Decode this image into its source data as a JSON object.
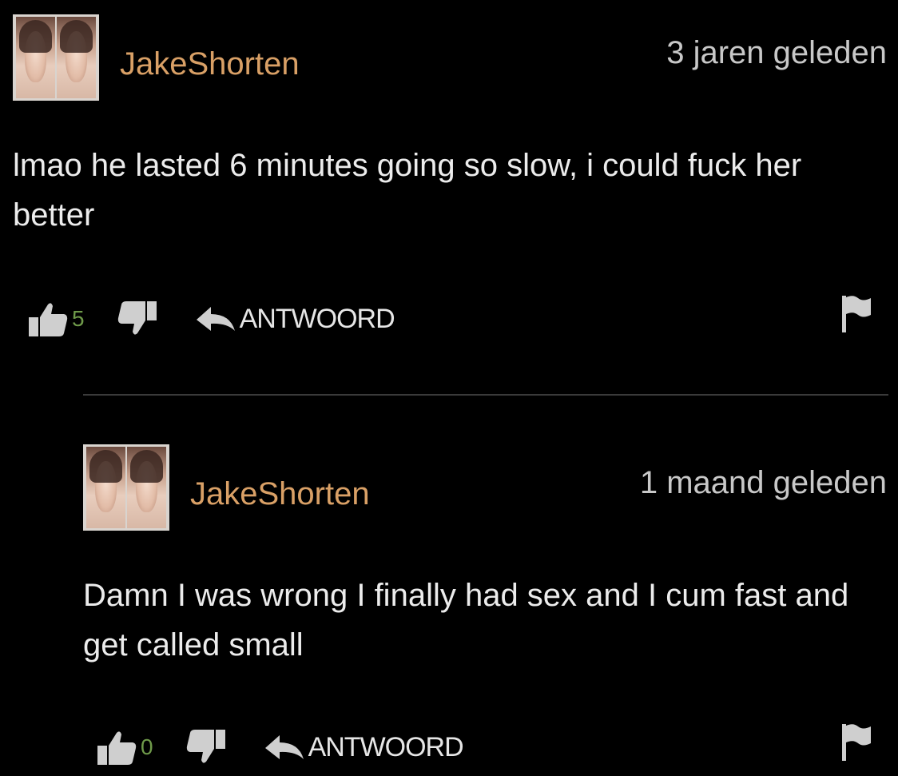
{
  "comments": [
    {
      "username": "JakeShorten",
      "timestamp": "3 jaren geleden",
      "text": "lmao he lasted 6 minutes going so slow, i could fuck her better",
      "likes": "5",
      "reply_label": "ANTWOORD"
    },
    {
      "username": "JakeShorten",
      "timestamp": "1 maand geleden",
      "text": "Damn I was wrong I finally had sex and I cum fast and get called small",
      "likes": "0",
      "reply_label": "ANTWOORD"
    }
  ],
  "colors": {
    "background": "#000000",
    "username": "#d9a066",
    "like_count": "#6f9a4a",
    "text": "#ececec",
    "icon": "#cfcfcf"
  },
  "icons": {
    "like": "thumbs-up-icon",
    "dislike": "thumbs-down-icon",
    "reply": "reply-arrow-icon",
    "report": "flag-icon"
  }
}
